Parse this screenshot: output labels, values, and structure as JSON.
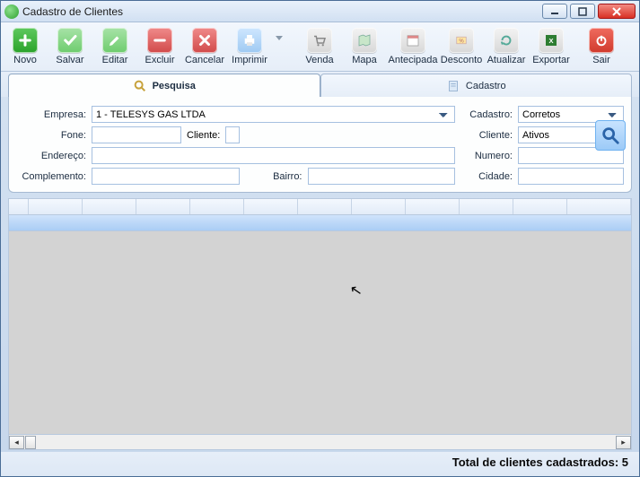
{
  "window": {
    "title": "Cadastro de Clientes"
  },
  "toolbar": {
    "novo": "Novo",
    "salvar": "Salvar",
    "editar": "Editar",
    "excluir": "Excluir",
    "cancelar": "Cancelar",
    "imprimir": "Imprimir",
    "venda": "Venda",
    "mapa": "Mapa",
    "antecipada": "Antecipada",
    "desconto": "Desconto",
    "atualizar": "Atualizar",
    "exportar": "Exportar",
    "sair": "Sair"
  },
  "tabs": {
    "pesquisa": "Pesquisa",
    "cadastro": "Cadastro"
  },
  "form": {
    "labels": {
      "empresa": "Empresa:",
      "fone": "Fone:",
      "cliente": "Cliente:",
      "endereco": "Endereço:",
      "complemento": "Complemento:",
      "bairro": "Bairro:",
      "cadastro": "Cadastro:",
      "clienteFilter": "Cliente:",
      "numero": "Numero:",
      "cidade": "Cidade:"
    },
    "values": {
      "empresa": "1 - TELESYS GAS LTDA",
      "fone": "",
      "cliente": "",
      "endereco": "",
      "complemento": "",
      "bairro": "",
      "numero": "",
      "cidade": "",
      "cadastroFilter": "Corretos",
      "clienteFilter": "Ativos"
    }
  },
  "footer": {
    "label": "Total de clientes cadastrados: 5"
  }
}
